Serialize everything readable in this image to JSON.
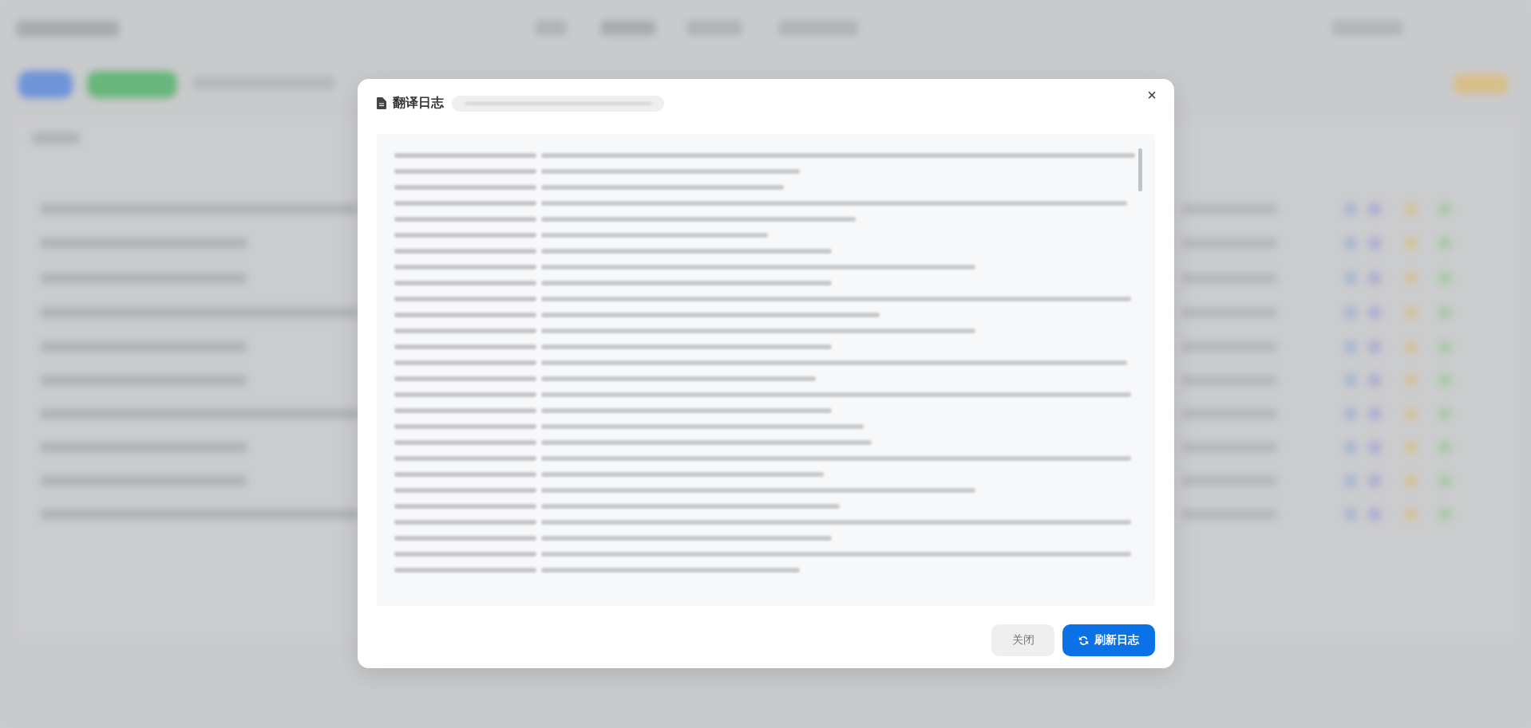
{
  "dialog": {
    "title": "翻译日志",
    "close": "×",
    "buttons": [
      {
        "label": "关闭",
        "kind": "secondary"
      },
      {
        "label": "刷新日志",
        "kind": "primary"
      }
    ]
  }
}
